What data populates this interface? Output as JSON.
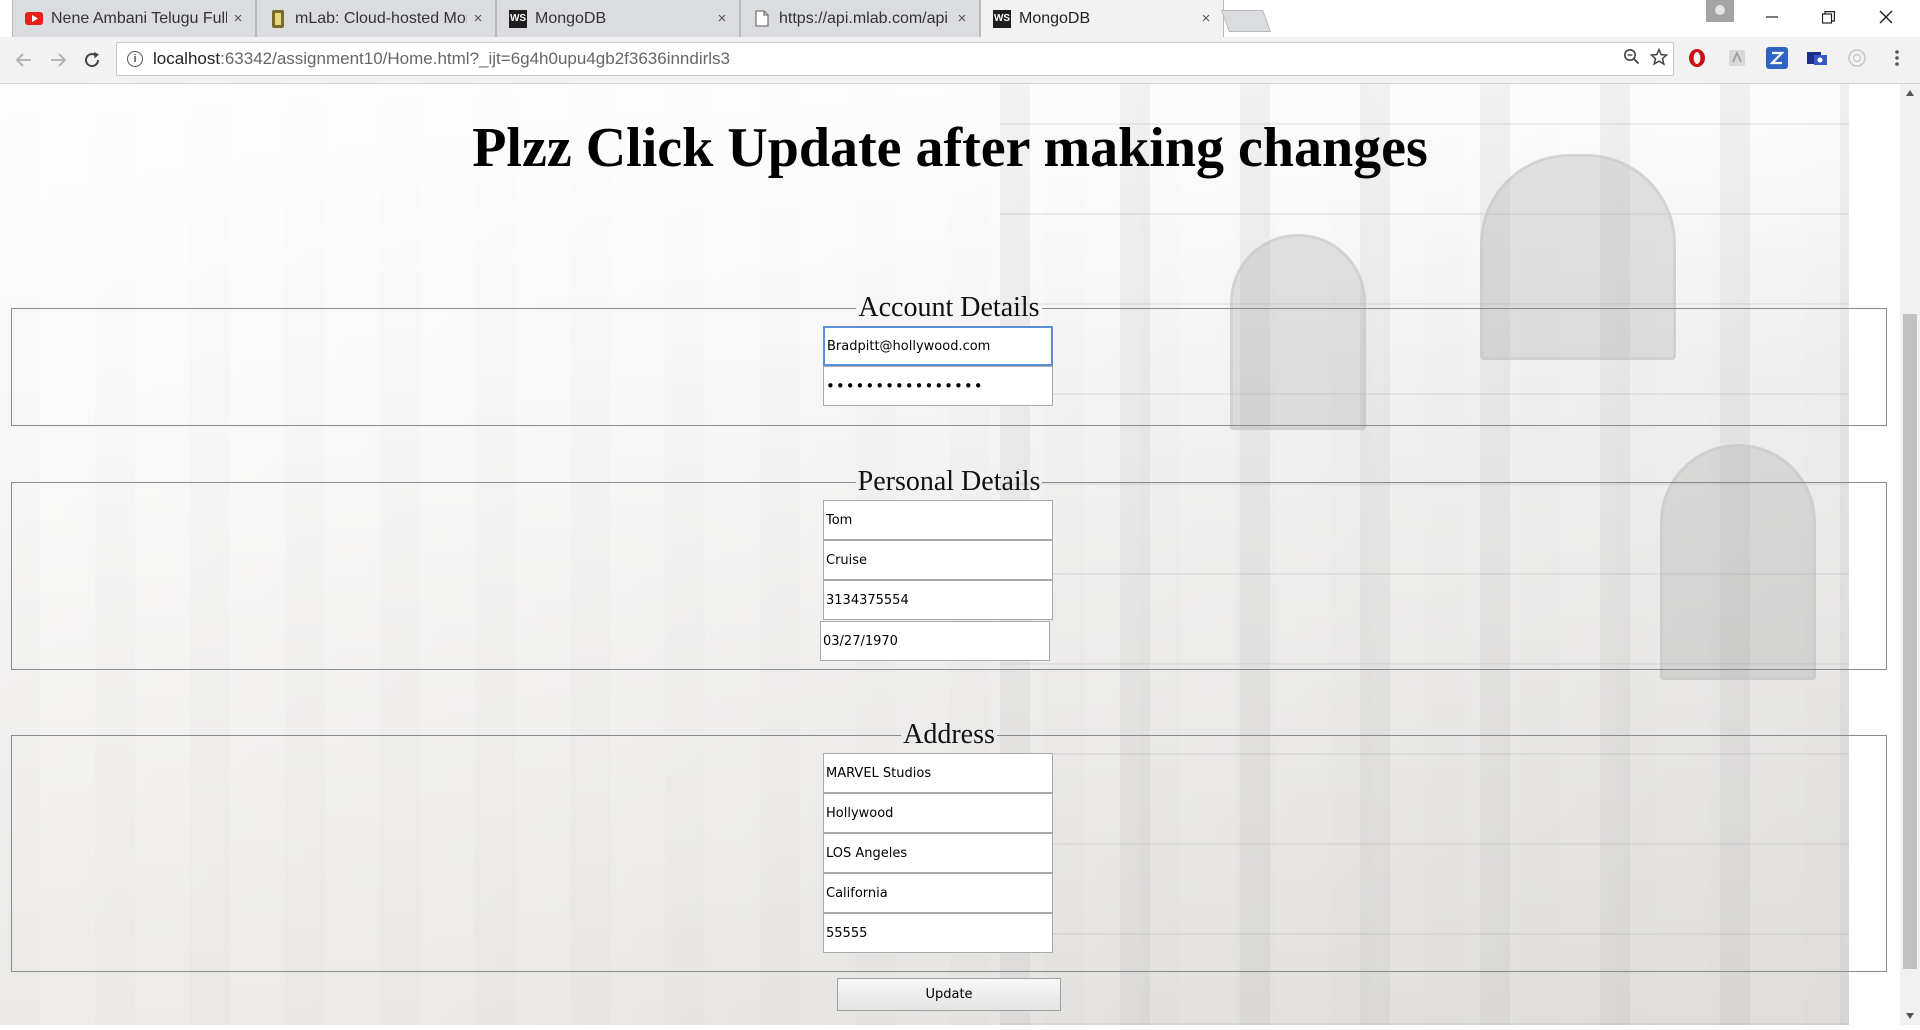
{
  "browser": {
    "tabs": [
      {
        "title": "Nene Ambani Telugu Full",
        "favicon": "youtube-icon",
        "favicon_color": "#e62117",
        "active": false
      },
      {
        "title": "mLab: Cloud-hosted Mon",
        "favicon": "mlab-icon",
        "favicon_color": "#7a6a2c",
        "active": false
      },
      {
        "title": "MongoDB",
        "favicon": "webstorm-icon",
        "favicon_color": "#1e1e1e",
        "active": false
      },
      {
        "title": "https://api.mlab.com/api",
        "favicon": "page-icon",
        "favicon_color": "#777777",
        "active": false
      },
      {
        "title": "MongoDB",
        "favicon": "webstorm-icon",
        "favicon_color": "#1e1e1e",
        "active": true
      }
    ],
    "tab_close_glyph": "×",
    "favicon_ws_text": "WS",
    "address_host": "localhost",
    "address_rest": ":63342/assignment10/Home.html?_ijt=6g4h0upu4gb2f3636inndirls3",
    "info_glyph": "i"
  },
  "page": {
    "heading": "Plzz Click Update after making changes",
    "account": {
      "legend": "Account Details",
      "email": "Bradpitt@hollywood.com",
      "password_mask": "••••••••••••••••"
    },
    "personal": {
      "legend": "Personal Details",
      "first_name": "Tom",
      "last_name": "Cruise",
      "phone": "3134375554",
      "dob": "03/27/1970"
    },
    "address": {
      "legend": "Address",
      "street": "MARVEL Studios",
      "area": "Hollywood",
      "city": "LOS Angeles",
      "state": "California",
      "zip": "55555"
    },
    "update_label": "Update"
  },
  "colors": {
    "opera": "#cc0f16",
    "zotero": "#2f64c2",
    "accent_focus": "#5b8fd8"
  }
}
